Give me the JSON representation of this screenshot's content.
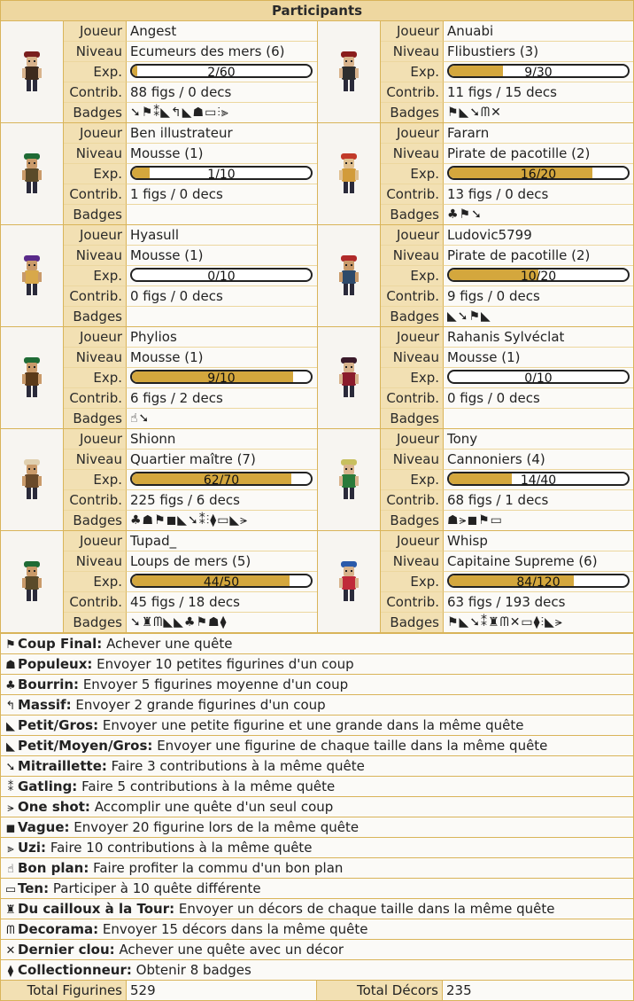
{
  "title": "Participants",
  "labels": {
    "player": "Joueur",
    "level": "Niveau",
    "exp": "Exp.",
    "contrib": "Contrib.",
    "badges": "Badges"
  },
  "players": [
    {
      "name": "Angest",
      "level": "Ecumeurs des mers (6)",
      "exp": "2/60",
      "progress": 0.033,
      "contrib": "88 figs / 0 decs",
      "badges": "➘⚑⁑◣↰◣☗▭⫶⫸",
      "colors": [
        "#7a1e1e",
        "#3d2a1d",
        "#d8b38c"
      ]
    },
    {
      "name": "Anuabi",
      "level": "Flibustiers (3)",
      "exp": "9/30",
      "progress": 0.3,
      "contrib": "11 figs / 15 decs",
      "badges": "⚑◣➘ᗰ✕",
      "colors": [
        "#8a1c1c",
        "#2e2e2e",
        "#d8b38c"
      ]
    },
    {
      "name": "Ben illustrateur",
      "level": "Mousse (1)",
      "exp": "1/10",
      "progress": 0.1,
      "contrib": "1 figs / 0 decs",
      "badges": "",
      "colors": [
        "#1f6b35",
        "#5a4a2a",
        "#c99a6a"
      ]
    },
    {
      "name": "Fararn",
      "level": "Pirate de pacotille (2)",
      "exp": "16/20",
      "progress": 0.8,
      "contrib": "13 figs / 0 decs",
      "badges": "♣⚑➘",
      "colors": [
        "#c23a2a",
        "#d29b3a",
        "#e0c090"
      ]
    },
    {
      "name": "Hyasull",
      "level": "Mousse (1)",
      "exp": "0/10",
      "progress": 0.0,
      "contrib": "0 figs / 0 decs",
      "badges": "",
      "colors": [
        "#5a2a8a",
        "#d8a84a",
        "#c99a6a"
      ]
    },
    {
      "name": "Ludovic5799",
      "level": "Pirate de pacotille (2)",
      "exp": "10/20",
      "progress": 0.5,
      "contrib": "9 figs / 0 decs",
      "badges": "◣➘⚑◣",
      "colors": [
        "#b02a2a",
        "#2e4a6a",
        "#c99a6a"
      ]
    },
    {
      "name": "Phylios",
      "level": "Mousse (1)",
      "exp": "9/10",
      "progress": 0.9,
      "contrib": "6 figs / 2 decs",
      "badges": "☝➘",
      "colors": [
        "#1f6b35",
        "#5a3a1a",
        "#c99a6a"
      ]
    },
    {
      "name": "Rahanis Sylvéclat",
      "level": "Mousse (1)",
      "exp": "0/10",
      "progress": 0.0,
      "contrib": "0 figs / 0 decs",
      "badges": "",
      "colors": [
        "#3a1a2a",
        "#8a1c2c",
        "#d8b38c"
      ]
    },
    {
      "name": "Shionn",
      "level": "Quartier maître (7)",
      "exp": "62/70",
      "progress": 0.886,
      "contrib": "225 figs / 6 decs",
      "badges": "♣☗⚑◼◣➘⁑⫶⧫▭◣⪫",
      "colors": [
        "#e0d0b0",
        "#6a4a2a",
        "#c99a6a"
      ]
    },
    {
      "name": "Tony",
      "level": "Cannoniers (4)",
      "exp": "14/40",
      "progress": 0.35,
      "contrib": "68 figs / 1 decs",
      "badges": "☗⪫◼⚑▭",
      "colors": [
        "#c8c060",
        "#2a7a3a",
        "#d8b38c"
      ]
    },
    {
      "name": "Tupad_",
      "level": "Loups de mers (5)",
      "exp": "44/50",
      "progress": 0.88,
      "contrib": "45 figs / 18 decs",
      "badges": "➘♜ᗰ◣◣♣⚑☗⧫",
      "colors": [
        "#1f6b35",
        "#5a4a2a",
        "#c99a6a"
      ]
    },
    {
      "name": "Whisp",
      "level": "Capitaine Supreme (6)",
      "exp": "84/120",
      "progress": 0.7,
      "contrib": "63 figs / 193 decs",
      "badges": "⚑◣➘⁑♜ᗰ✕▭⧫⫶◣⪫",
      "colors": [
        "#2a5aaa",
        "#c02a3a",
        "#d8b38c"
      ]
    }
  ],
  "legend": [
    {
      "icon": "⚑",
      "icon_name": "flag-icon",
      "name": "Coup Final:",
      "desc": "Achever une quête"
    },
    {
      "icon": "☗",
      "icon_name": "crowd-icon",
      "name": "Populeux:",
      "desc": "Envoyer 10 petites figurines d'un coup"
    },
    {
      "icon": "♣",
      "icon_name": "paw-icon",
      "name": "Bourrin:",
      "desc": "Envoyer 5 figurines moyenne d'un coup"
    },
    {
      "icon": "↰",
      "icon_name": "giant-icon",
      "name": "Massif:",
      "desc": "Envoyer 2 grande figurines d'un coup"
    },
    {
      "icon": "◣",
      "icon_name": "dragon-icon",
      "name": "Petit/Gros:",
      "desc": "Envoyer une petite figurine et une grande dans la même quête"
    },
    {
      "icon": "◣",
      "icon_name": "dragons-icon",
      "name": "Petit/Moyen/Gros:",
      "desc": "Envoyer une figurine de chaque taille dans la même quête"
    },
    {
      "icon": "➘",
      "icon_name": "machine-gun-icon",
      "name": "Mitraillette:",
      "desc": "Faire 3 contributions à la même quête"
    },
    {
      "icon": "⁑",
      "icon_name": "gatling-icon",
      "name": "Gatling:",
      "desc": "Faire 5 contributions à la même quête"
    },
    {
      "icon": "⪫",
      "icon_name": "one-shot-icon",
      "name": "One shot:",
      "desc": "Accomplir une quête d'un seul coup"
    },
    {
      "icon": "◼",
      "icon_name": "wave-icon",
      "name": "Vague:",
      "desc": "Envoyer 20 figurine lors de la même quête"
    },
    {
      "icon": "⫸",
      "icon_name": "uzi-icon",
      "name": "Uzi:",
      "desc": "Faire 10 contributions à la même quête"
    },
    {
      "icon": "☝",
      "icon_name": "thumbs-up-icon",
      "name": "Bon plan:",
      "desc": "Faire profiter la commu d'un bon plan"
    },
    {
      "icon": "▭",
      "icon_name": "battery-icon",
      "name": "Ten:",
      "desc": "Participer à 10 quête différente"
    },
    {
      "icon": "♜",
      "icon_name": "tower-icon",
      "name": "Du cailloux à la Tour:",
      "desc": "Envoyer un décors de chaque taille dans la même quête"
    },
    {
      "icon": "ᗰ",
      "icon_name": "arch-icon",
      "name": "Decorama:",
      "desc": "Envoyer 15 décors dans la même quête"
    },
    {
      "icon": "✕",
      "icon_name": "hammer-icon",
      "name": "Dernier clou:",
      "desc": "Achever une quête avec un décor"
    },
    {
      "icon": "⧫",
      "icon_name": "collector-icon",
      "name": "Collectionneur:",
      "desc": "Obtenir 8 badges"
    }
  ],
  "totals": {
    "fig_label": "Total Figurines",
    "fig_value": "529",
    "dec_label": "Total Décors",
    "dec_value": "235"
  }
}
